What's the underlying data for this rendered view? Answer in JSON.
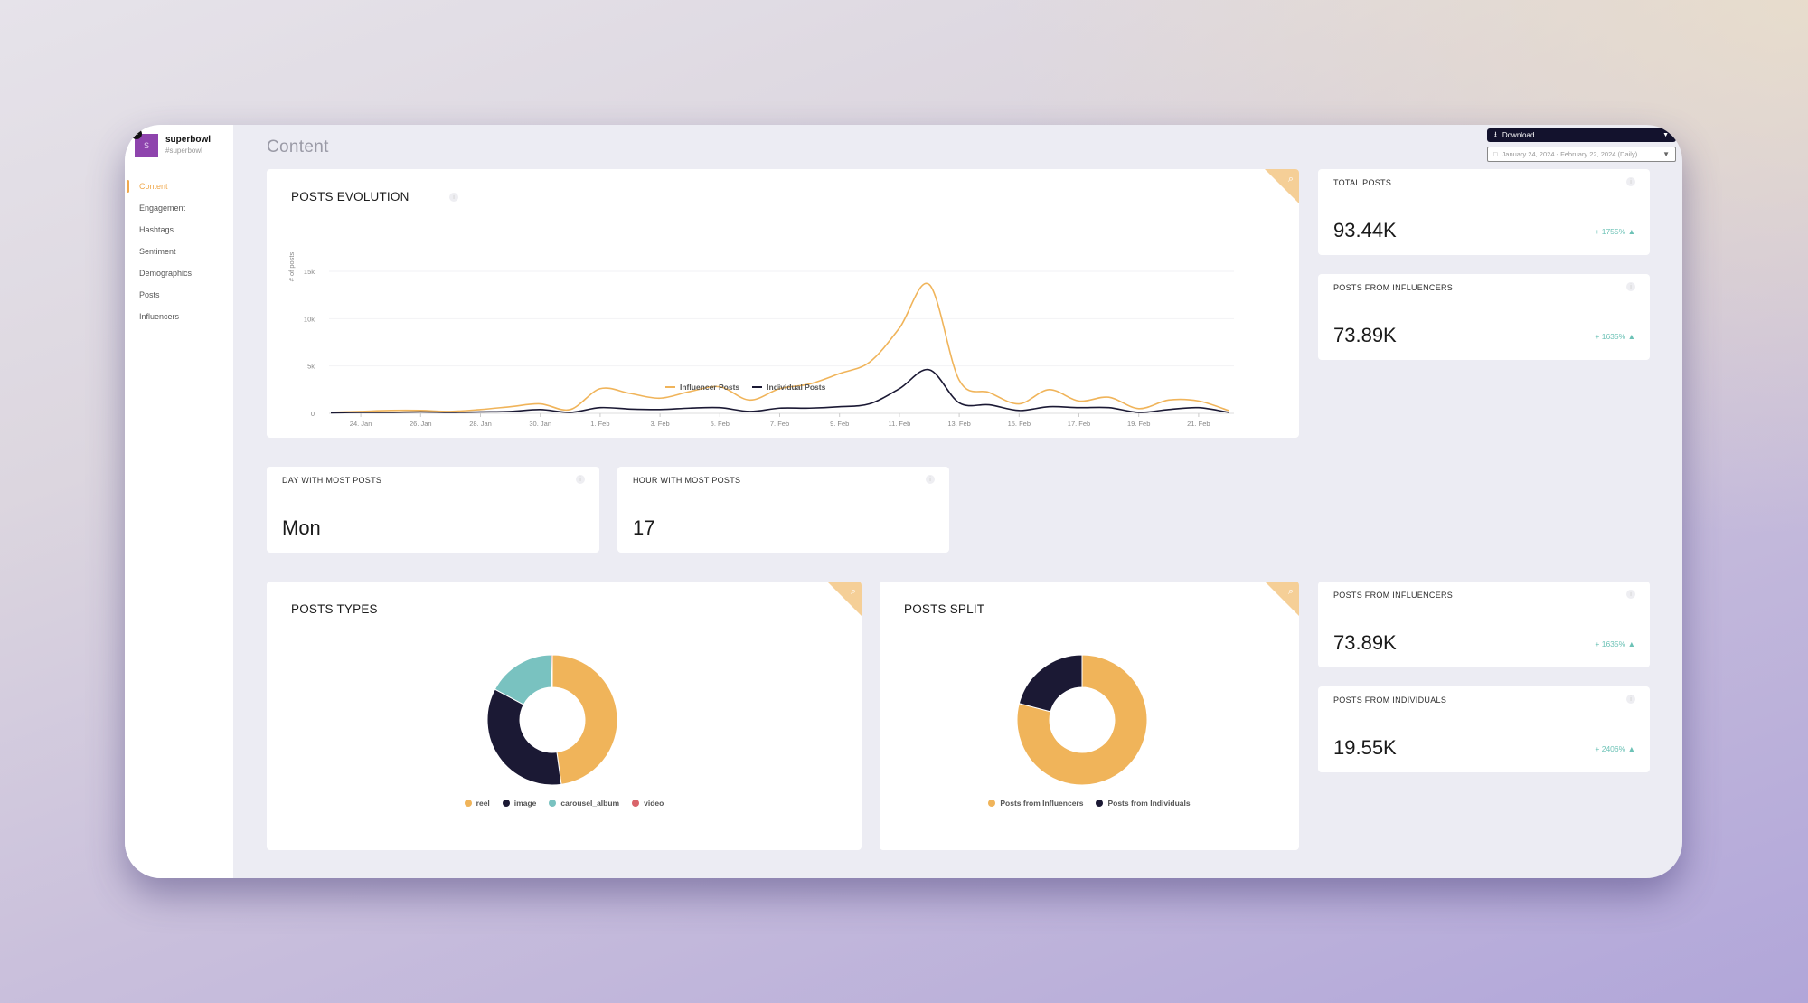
{
  "brand": {
    "initial": "S",
    "badge": "#",
    "name": "superbowl",
    "tag": "#superbowl"
  },
  "sidebar": {
    "items": [
      {
        "label": "Content",
        "active": true
      },
      {
        "label": "Engagement",
        "active": false
      },
      {
        "label": "Hashtags",
        "active": false
      },
      {
        "label": "Sentiment",
        "active": false
      },
      {
        "label": "Demographics",
        "active": false
      },
      {
        "label": "Posts",
        "active": false
      },
      {
        "label": "Influencers",
        "active": false
      }
    ]
  },
  "header": {
    "title": "Content",
    "download_label": "Download",
    "download_icon": "download-icon",
    "date_range": "January 24, 2024 - February 22, 2024 (Daily)",
    "date_icon": "calendar-icon"
  },
  "colors": {
    "accent": "#f0a94e",
    "influencer": "#f0b45a",
    "individual": "#1b1934",
    "reel": "#f0b45a",
    "image": "#1b1934",
    "carousel_album": "#79c2c0",
    "video": "#d9646a",
    "positive": "#6cc2b6"
  },
  "cards": {
    "evolution_title": "POSTS EVOLUTION",
    "day_most": {
      "label": "DAY WITH MOST POSTS",
      "value": "Mon"
    },
    "hour_most": {
      "label": "HOUR WITH MOST POSTS",
      "value": "17"
    },
    "types_title": "POSTS TYPES",
    "split_title": "POSTS SPLIT"
  },
  "stats": [
    {
      "label": "TOTAL POSTS",
      "value": "93.44K",
      "change": "+ 1755%"
    },
    {
      "label": "POSTS FROM INFLUENCERS",
      "value": "73.89K",
      "change": "+ 1635%"
    },
    {
      "label": "POSTS FROM INFLUENCERS",
      "value": "73.89K",
      "change": "+ 1635%"
    },
    {
      "label": "POSTS FROM INDIVIDUALS",
      "value": "19.55K",
      "change": "+ 2406%"
    }
  ],
  "chart_data": [
    {
      "type": "line",
      "title": "POSTS EVOLUTION",
      "xlabel": "",
      "ylabel": "# of posts",
      "ylim": [
        0,
        15000
      ],
      "yticks": [
        "0",
        "5k",
        "10k",
        "15k"
      ],
      "ytick_values": [
        0,
        5000,
        10000,
        15000
      ],
      "grid": true,
      "legend": "bottom-center",
      "x": [
        "23. Jan",
        "24. Jan",
        "25. Jan",
        "26. Jan",
        "27. Jan",
        "28. Jan",
        "29. Jan",
        "30. Jan",
        "31. Jan",
        "1. Feb",
        "2. Feb",
        "3. Feb",
        "4. Feb",
        "5. Feb",
        "6. Feb",
        "7. Feb",
        "8. Feb",
        "9. Feb",
        "10. Feb",
        "11. Feb",
        "12. Feb",
        "13. Feb",
        "14. Feb",
        "15. Feb",
        "16. Feb",
        "17. Feb",
        "18. Feb",
        "19. Feb",
        "20. Feb",
        "21. Feb",
        "22. Feb"
      ],
      "xtick_labels": [
        "24. Jan",
        "26. Jan",
        "28. Jan",
        "30. Jan",
        "1. Feb",
        "3. Feb",
        "5. Feb",
        "7. Feb",
        "9. Feb",
        "11. Feb",
        "13. Feb",
        "15. Feb",
        "17. Feb",
        "19. Feb",
        "21. Feb"
      ],
      "series": [
        {
          "name": "Influencer Posts",
          "values": [
            100,
            200,
            300,
            300,
            200,
            400,
            700,
            1000,
            400,
            2600,
            2100,
            1600,
            2300,
            2800,
            1400,
            2600,
            3100,
            4200,
            5400,
            9000,
            13600,
            3500,
            2200,
            1000,
            2500,
            1300,
            1700,
            500,
            1400,
            1300,
            300
          ]
        },
        {
          "name": "Individual Posts",
          "values": [
            50,
            100,
            100,
            150,
            100,
            150,
            200,
            400,
            100,
            600,
            450,
            400,
            550,
            600,
            200,
            550,
            550,
            700,
            1000,
            2600,
            4600,
            1100,
            900,
            300,
            700,
            600,
            600,
            100,
            400,
            600,
            100
          ]
        }
      ]
    },
    {
      "type": "pie",
      "title": "POSTS TYPES",
      "legend": "bottom-center",
      "categories": [
        "reel",
        "image",
        "carousel_album",
        "video"
      ],
      "values": [
        47.8,
        35.0,
        16.9,
        0.3
      ],
      "unit": "percent (estimated)"
    },
    {
      "type": "pie",
      "title": "POSTS SPLIT",
      "legend": "bottom-center",
      "categories": [
        "Posts from Influencers",
        "Posts from Individuals"
      ],
      "values": [
        73890,
        19550
      ]
    }
  ]
}
